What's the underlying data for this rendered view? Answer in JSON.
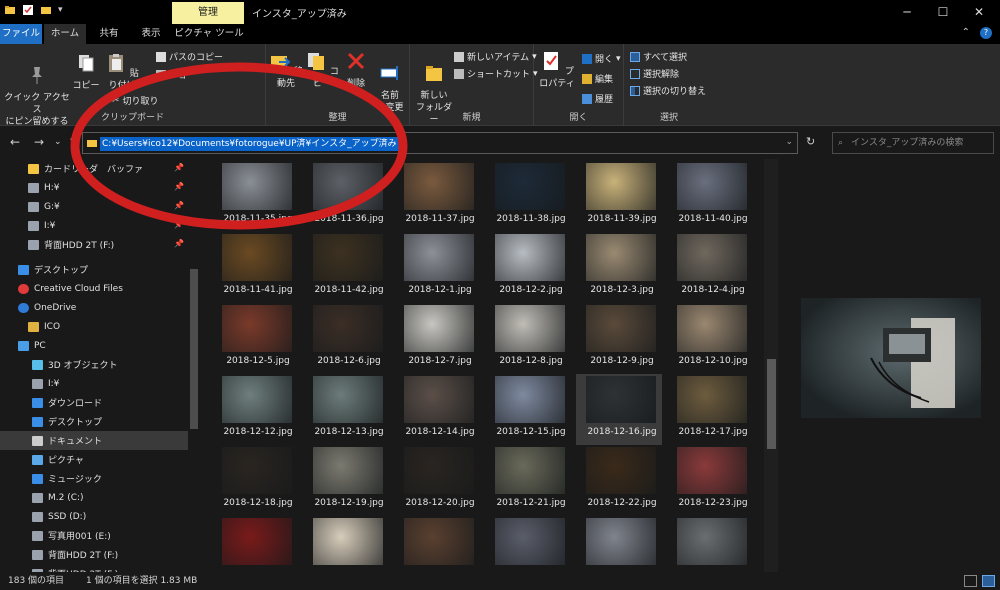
{
  "window": {
    "title": "インスタ_アップ済み",
    "context_tab": "管理",
    "minimize": "─",
    "maximize": "☐",
    "close": "✕"
  },
  "tabs": [
    "ファイル",
    "ホーム",
    "共有",
    "表示",
    "ピクチャ ツール"
  ],
  "ribbon": {
    "clipboard": {
      "label": "クリップボード",
      "pin": "クイック アクセス\nにピン留めする",
      "copy": "コピー",
      "paste": "貼り付け",
      "copy_path": "パスのコピー",
      "shortcut_paste": "ショ",
      "cut": "切り取り"
    },
    "organize": {
      "label": "整理",
      "move": "移動先",
      "copy_to": "コピー",
      "delete": "削除",
      "rename": "名前\nの変更"
    },
    "new": {
      "label": "新規",
      "new_folder": "新しい\nフォルダー",
      "new_item": "新しいアイテム",
      "shortcut": "ショートカット"
    },
    "open": {
      "label": "開く",
      "properties": "プロパティ",
      "open": "開く",
      "edit": "編集",
      "history": "履歴"
    },
    "select": {
      "label": "選択",
      "select_all": "すべて選択",
      "select_none": "選択解除",
      "invert": "選択の切り替え"
    }
  },
  "address": {
    "path": "C:¥Users¥ico12¥Documents¥fotorogue¥UP済¥インスタ_アップ済み",
    "search_placeholder": "インスタ_アップ済みの検索"
  },
  "sidebar": [
    {
      "label": "カードリーダ　バッファ",
      "icon": "folder-icon",
      "pinned": true
    },
    {
      "label": "H:¥",
      "icon": "drive-icon",
      "pinned": true
    },
    {
      "label": "G:¥",
      "icon": "drive-icon",
      "pinned": true
    },
    {
      "label": "I:¥",
      "icon": "drive-icon",
      "pinned": true
    },
    {
      "label": "背面HDD 2T (F:)",
      "icon": "drive-icon",
      "pinned": true
    },
    {
      "label": "デスクトップ",
      "icon": "desktop-icon",
      "pinned": false
    },
    {
      "label": "Creative Cloud Files",
      "icon": "cloud-icon",
      "pinned": false
    },
    {
      "label": "OneDrive",
      "icon": "onedrive-icon",
      "pinned": false
    },
    {
      "label": "ICO",
      "icon": "user-icon",
      "pinned": false
    },
    {
      "label": "PC",
      "icon": "pc-icon",
      "pinned": false
    },
    {
      "label": "3D オブジェクト",
      "icon": "cube-icon",
      "pinned": false
    },
    {
      "label": "I:¥",
      "icon": "drive-icon",
      "pinned": false
    },
    {
      "label": "ダウンロード",
      "icon": "download-icon",
      "pinned": false
    },
    {
      "label": "デスクトップ",
      "icon": "desktop-icon",
      "pinned": false
    },
    {
      "label": "ドキュメント",
      "icon": "document-icon",
      "pinned": false
    },
    {
      "label": "ピクチャ",
      "icon": "picture-icon",
      "pinned": false
    },
    {
      "label": "ミュージック",
      "icon": "music-icon",
      "pinned": false
    },
    {
      "label": "M.2 (C:)",
      "icon": "drive-icon",
      "pinned": false
    },
    {
      "label": "SSD (D:)",
      "icon": "drive-icon",
      "pinned": false
    },
    {
      "label": "写真用001 (E:)",
      "icon": "drive-icon",
      "pinned": false
    },
    {
      "label": "背面HDD 2T (F:)",
      "icon": "drive-icon",
      "pinned": false
    },
    {
      "label": "背面HDD 2T (F:)",
      "icon": "drive-icon",
      "pinned": false
    }
  ],
  "files": [
    "2018-11-35.jpg",
    "2018-11-36.jpg",
    "2018-11-37.jpg",
    "2018-11-38.jpg",
    "2018-11-39.jpg",
    "2018-11-40.jpg",
    "2018-11-41.jpg",
    "2018-11-42.jpg",
    "2018-12-1.jpg",
    "2018-12-2.jpg",
    "2018-12-3.jpg",
    "2018-12-4.jpg",
    "2018-12-5.jpg",
    "2018-12-6.jpg",
    "2018-12-7.jpg",
    "2018-12-8.jpg",
    "2018-12-9.jpg",
    "2018-12-10.jpg",
    "2018-12-12.jpg",
    "2018-12-13.jpg",
    "2018-12-14.jpg",
    "2018-12-15.jpg",
    "2018-12-16.jpg",
    "2018-12-17.jpg",
    "2018-12-18.jpg",
    "2018-12-19.jpg",
    "2018-12-20.jpg",
    "2018-12-21.jpg",
    "2018-12-22.jpg",
    "2018-12-23.jpg",
    "",
    "",
    "",
    "",
    "",
    ""
  ],
  "thumb_colors": [
    "#8a8f96",
    "#5d6066",
    "#7a5a3e",
    "#1d2a38",
    "#c9b27a",
    "#6a6f7e",
    "#6b4a22",
    "#3d3120",
    "#8d9098",
    "#b7bcc2",
    "#9a8a72",
    "#70685e",
    "#7a3a2a",
    "#3b2e26",
    "#c8c6c0",
    "#c0bdb6",
    "#5a4a3a",
    "#9a8770",
    "#6f7f7e",
    "#6c7c7a",
    "#5b4f48",
    "#7f8aa0",
    "#2d3234",
    "#6d5c3e",
    "#2a2520",
    "#7b7a70",
    "#2a2520",
    "#6a6a5a",
    "#3a2a1a",
    "#8a3a3a",
    "#7a1a1a",
    "#d8cdbb",
    "#5a4030",
    "#5a5e6a",
    "#80848e",
    "#6a6e70"
  ],
  "selected_file": "2018-12-16.jpg",
  "status": {
    "count": "183 個の項目",
    "selection": "1 個の項目を選択  1.83 MB"
  },
  "colors": {
    "accent": "#1f6fc5",
    "selection": "#0a63c9",
    "annotation": "#d01f1f"
  }
}
